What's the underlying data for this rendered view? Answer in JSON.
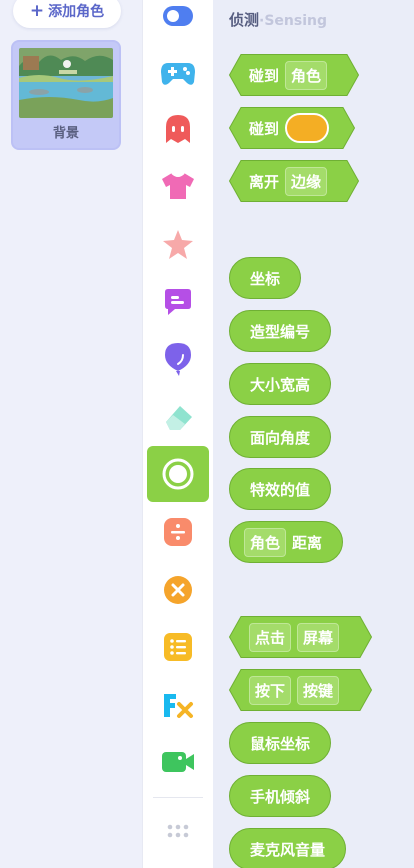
{
  "sprites": {
    "add_label": "添加角色",
    "background_label": "背景"
  },
  "palette": {
    "title": "侦测",
    "subtitle": "·Sensing",
    "blocks": {
      "touch": "碰到",
      "touch_target": "角色",
      "touch_color": "碰到",
      "leave": "离开",
      "leave_target": "边缘",
      "coords": "坐标",
      "costume_no": "造型编号",
      "size": "大小宽高",
      "direction": "面向角度",
      "effect": "特效的值",
      "distance_target": "角色",
      "distance": "距离",
      "click": "点击",
      "click_target": "屏幕",
      "press": "按下",
      "press_target": "按键",
      "mouse_coords": "鼠标坐标",
      "tilt": "手机倾斜",
      "mic": "麦克风音量"
    }
  },
  "colors": {
    "sensing_green": "#8bd046",
    "touch_color_value": "#f4ae24"
  },
  "categories": [
    {
      "icon": "toggle-icon"
    },
    {
      "icon": "gamepad-icon"
    },
    {
      "icon": "ghost-icon"
    },
    {
      "icon": "shirt-icon"
    },
    {
      "icon": "star-icon"
    },
    {
      "icon": "speech-bubble-icon"
    },
    {
      "icon": "balloon-icon"
    },
    {
      "icon": "eraser-icon"
    },
    {
      "icon": "sensing-target-icon",
      "active": true
    },
    {
      "icon": "divide-icon"
    },
    {
      "icon": "cross-circle-icon"
    },
    {
      "icon": "list-icon"
    },
    {
      "icon": "fx-icon"
    },
    {
      "icon": "video-camera-icon"
    },
    {
      "icon": "more-dots-icon"
    }
  ]
}
